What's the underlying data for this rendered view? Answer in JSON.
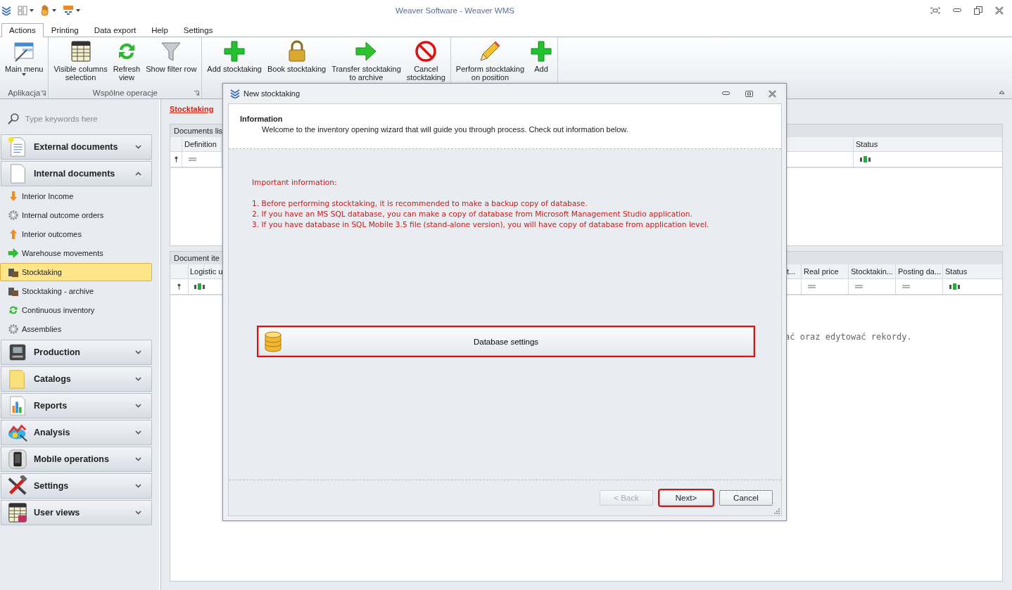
{
  "window": {
    "title": "Weaver Software - Weaver WMS"
  },
  "tabs": [
    {
      "label": "Actions",
      "selected": true
    },
    {
      "label": "Printing",
      "selected": false
    },
    {
      "label": "Data export",
      "selected": false
    },
    {
      "label": "Help",
      "selected": false
    },
    {
      "label": "Settings",
      "selected": false
    }
  ],
  "ribbon_groups": [
    {
      "label": "Aplikacja",
      "launcher": true,
      "buttons": [
        {
          "label": "Main menu",
          "kind": "menu",
          "dropdown": true
        }
      ]
    },
    {
      "label": "Wspólne operacje",
      "launcher": true,
      "buttons": [
        {
          "label": "Visible columns\nselection",
          "kind": "columns"
        },
        {
          "label": "Refresh\nview",
          "kind": "refresh"
        },
        {
          "label": "Show filter row",
          "kind": "filter"
        }
      ]
    },
    {
      "buttons": [
        {
          "label": "Add stocktaking",
          "kind": "add"
        },
        {
          "label": "Book stocktaking",
          "kind": "book"
        },
        {
          "label": "Transfer stocktaking\nto archive",
          "kind": "transfer"
        },
        {
          "label": "Cancel\nstocktaking",
          "kind": "cancel"
        }
      ]
    },
    {
      "buttons": [
        {
          "label": "Perform stocktaking\non position",
          "kind": "edit"
        },
        {
          "label": "Add",
          "kind": "add"
        }
      ]
    }
  ],
  "sidebar": {
    "search": {
      "placeholder": "Type keywords here"
    },
    "groups": [
      {
        "label": "External documents",
        "kind": "external",
        "expanded": false
      },
      {
        "label": "Internal documents",
        "kind": "internal",
        "expanded": true,
        "items": [
          {
            "label": "Interior Income",
            "kind": "income",
            "selected": false
          },
          {
            "label": "Internal outcome orders",
            "kind": "orders",
            "selected": false
          },
          {
            "label": "Interior outcomes",
            "kind": "outcomes",
            "selected": false
          },
          {
            "label": "Warehouse movements",
            "kind": "movements",
            "selected": false
          },
          {
            "label": "Stocktaking",
            "kind": "stocktaking",
            "selected": true
          },
          {
            "label": "Stocktaking - archive",
            "kind": "stocktaking",
            "selected": false
          },
          {
            "label": "Continuous inventory",
            "kind": "continuous",
            "selected": false
          },
          {
            "label": "Assemblies",
            "kind": "assemblies",
            "selected": false
          }
        ]
      },
      {
        "label": "Production",
        "kind": "production",
        "expanded": false
      },
      {
        "label": "Catalogs",
        "kind": "catalogs",
        "expanded": false
      },
      {
        "label": "Reports",
        "kind": "reports",
        "expanded": false
      },
      {
        "label": "Analysis",
        "kind": "analysis",
        "expanded": false
      },
      {
        "label": "Mobile operations",
        "kind": "mobile",
        "expanded": false
      },
      {
        "label": "Settings",
        "kind": "settings",
        "expanded": false
      },
      {
        "label": "User views",
        "kind": "views",
        "expanded": false
      }
    ]
  },
  "breadcrumb": "Stocktaking",
  "grids": [
    {
      "title": "Documents lis",
      "columns": [
        {
          "label": "Definition",
          "kind": "equals"
        },
        {
          "label": "Status",
          "kind": "text"
        }
      ]
    },
    {
      "title": "Document ite",
      "columns": [
        {
          "label": "Logistic u",
          "kind": "text"
        },
        {
          "label": "t..."
        },
        {
          "label": "Real price",
          "kind": "equals"
        },
        {
          "label": "Stocktakin...",
          "kind": "equals"
        },
        {
          "label": "Posting da...",
          "kind": "equals"
        },
        {
          "label": "Status",
          "kind": "text"
        }
      ],
      "message": "ać oraz edytować rekordy."
    }
  ],
  "dialog": {
    "title": "New stocktaking",
    "header_title": "Information",
    "header_text": "Welcome to the inventory opening wizard that will guide you through process. Check out information below.",
    "heading": "Important information:",
    "lines": [
      "1. Before performing stocktaking, it is recommended to make a backup copy of  database.",
      "2. If you have an MS SQL database, you can make a copy of database from Microsoft Management Studio application.",
      "3. If you have database in SQL Mobile 3.5 file (stand-alone version), you will have copy of database from application level."
    ],
    "action": {
      "label": "Database settings",
      "highlighted": true
    },
    "buttons": [
      {
        "label": "< Back",
        "disabled": true,
        "highlighted": false,
        "focused": false
      },
      {
        "label": "Next>",
        "disabled": false,
        "highlighted": true,
        "focused": false
      },
      {
        "label": "Cancel",
        "disabled": false,
        "highlighted": false,
        "focused": true
      }
    ]
  }
}
